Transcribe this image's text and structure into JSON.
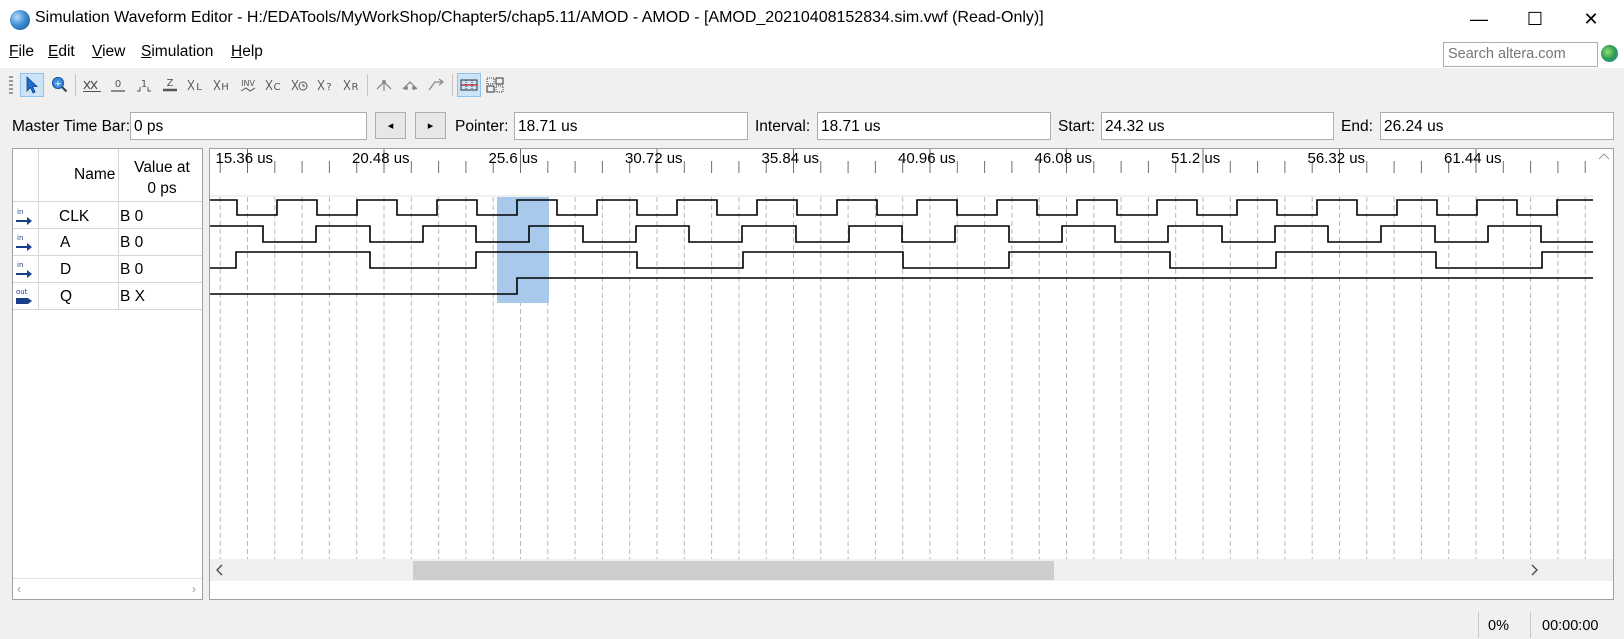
{
  "window": {
    "title": "Simulation Waveform Editor - H:/EDATools/MyWorkShop/Chapter5/chap5.11/AMOD - AMOD - [AMOD_20210408152834.sim.vwf (Read-Only)]",
    "minimize": "—",
    "maximize": "☐",
    "close": "✕"
  },
  "menu": {
    "file_u": "F",
    "file_rest": "ile",
    "edit_u": "E",
    "edit_rest": "dit",
    "view_u": "V",
    "view_rest": "iew",
    "sim_u": "S",
    "sim_rest": "imulation",
    "help_u": "H",
    "help_rest": "elp"
  },
  "search": {
    "placeholder": "Search altera.com"
  },
  "toolbar": {
    "icons": [
      "pointer-icon",
      "zoom-icon",
      "uninitialized-icon",
      "force-low-icon",
      "force-high-icon",
      "high-impedance-icon",
      "weak-low-icon",
      "weak-high-icon",
      "invert-icon",
      "count-value-icon",
      "clock-icon",
      "arbitrary-value-icon",
      "random-value-icon",
      "snap-to-grid-icon",
      "group-icon",
      "ungroup-icon",
      "reverse-group-icon",
      "grid-settings-icon",
      "select-all-icon"
    ]
  },
  "timebar": {
    "master_label": "Master Time Bar:",
    "master_value": "0 ps",
    "prev": "◂",
    "next": "▸",
    "pointer_label": "Pointer:",
    "pointer_value": "18.71 us",
    "interval_label": "Interval:",
    "interval_value": "18.71 us",
    "start_label": "Start:",
    "start_value": "24.32 us",
    "end_label": "End:",
    "end_value": "26.24 us"
  },
  "name_panel": {
    "name_header": "Name",
    "value_header_line1": "Value at",
    "value_header_line2": "0 ps",
    "signals": [
      {
        "direction": "in",
        "name": "CLK",
        "value": "B 0"
      },
      {
        "direction": "in",
        "name": "A",
        "value": "B 0"
      },
      {
        "direction": "in",
        "name": "D",
        "value": "B 0"
      },
      {
        "direction": "out",
        "name": "Q",
        "value": "B X"
      }
    ]
  },
  "timescale": {
    "labels": [
      "15.36 us",
      "20.48 us",
      "25.6 us",
      "30.72 us",
      "35.84 us",
      "40.96 us",
      "46.08 us",
      "51.2 us",
      "56.32 us",
      "61.44 us"
    ]
  },
  "colors": {
    "selection": "#a9c9ec",
    "grid": "#b9b9b9",
    "wave": "#000000",
    "scroll_thumb": "#cdcdcd"
  },
  "status": {
    "progress": "0%",
    "elapsed": "00:00:00"
  }
}
